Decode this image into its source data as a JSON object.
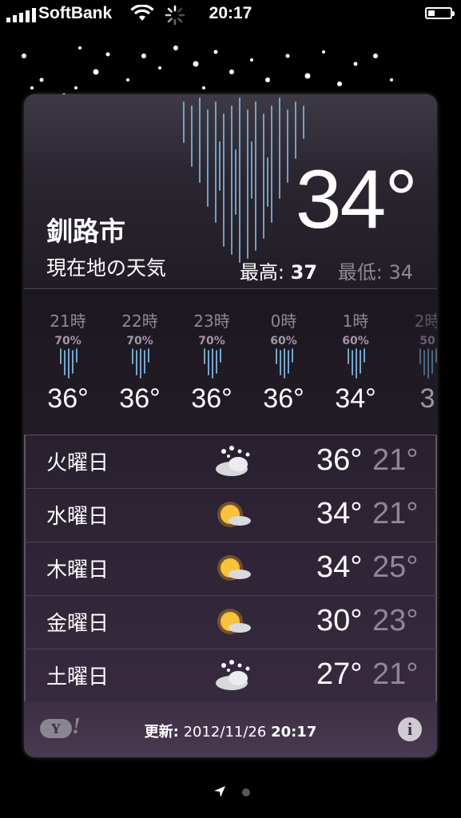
{
  "status_bar": {
    "carrier": "SoftBank",
    "time": "20:17",
    "battery_level": 0.3
  },
  "current": {
    "city": "釧路市",
    "subtitle": "現在地の天気",
    "temperature": "34°",
    "high_label": "最高:",
    "high_value": "37",
    "low_label": "最低:",
    "low_value": "34",
    "condition_icon": "heavy-rain-icon"
  },
  "hourly": [
    {
      "time": "21時",
      "precip": "70%",
      "temp": "36°",
      "icon": "rain-icon"
    },
    {
      "time": "22時",
      "precip": "70%",
      "temp": "36°",
      "icon": "rain-icon"
    },
    {
      "time": "23時",
      "precip": "70%",
      "temp": "36°",
      "icon": "rain-icon"
    },
    {
      "time": "0時",
      "precip": "60%",
      "temp": "36°",
      "icon": "rain-icon"
    },
    {
      "time": "1時",
      "precip": "60%",
      "temp": "34°",
      "icon": "rain-icon"
    },
    {
      "time": "2時",
      "precip": "50",
      "temp": "3",
      "icon": "rain-icon"
    }
  ],
  "daily": [
    {
      "day": "火曜日",
      "icon": "snow-icon",
      "high": "36°",
      "low": "21°"
    },
    {
      "day": "水曜日",
      "icon": "sun-cloud-icon",
      "high": "34°",
      "low": "21°"
    },
    {
      "day": "木曜日",
      "icon": "sun-cloud-icon",
      "high": "34°",
      "low": "25°"
    },
    {
      "day": "金曜日",
      "icon": "sun-cloud-icon",
      "high": "30°",
      "low": "23°"
    },
    {
      "day": "土曜日",
      "icon": "snow-icon",
      "high": "27°",
      "low": "21°"
    }
  ],
  "footer": {
    "yahoo_logo": "Y!",
    "updated_label": "更新:",
    "updated_date": "2012/11/26",
    "updated_time": "20:17",
    "info_icon": "info-icon"
  },
  "colors": {
    "card_bg": "#2b2230",
    "dim_text": "#8d8893",
    "rain": "#7fb6e0"
  }
}
